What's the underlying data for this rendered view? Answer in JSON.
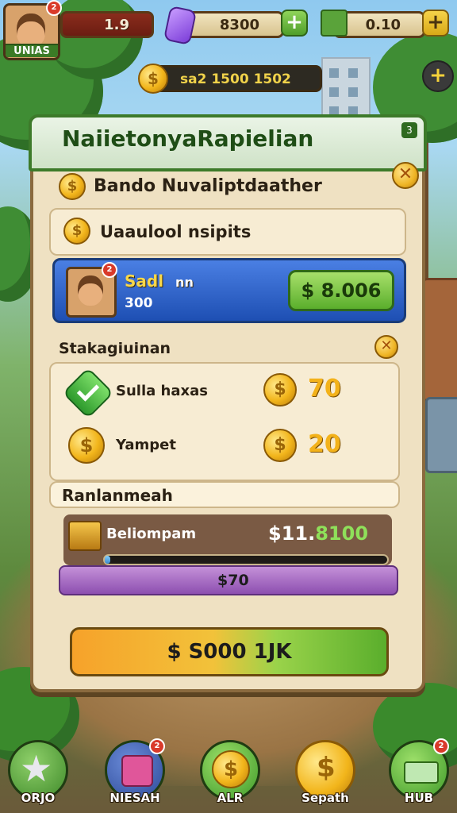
{
  "hud": {
    "player_label": "UNIAS",
    "player_badge": "2",
    "resource_1": "1.9",
    "resource_2": "8300",
    "resource_3": "0.10",
    "coins": "sa2 1500 1502"
  },
  "panel": {
    "title": "NaiietonyaRapielian",
    "title_badge": "3",
    "header_line": "Bando Nuvaliptdaather",
    "subheader": "Uaaulool nsipits",
    "player": {
      "name": "Sadl",
      "suffix": "nn",
      "value": "300",
      "badge": "2",
      "price": "$ 8.006"
    },
    "section_label": "Stakagiuinan",
    "rewards": [
      {
        "label": "Sulla haxas",
        "amount": "70",
        "icon": "check-icon"
      },
      {
        "label": "Yampet",
        "amount": "20",
        "icon": "coin-icon"
      }
    ],
    "upgrade_section_label": "Ranlanmeah",
    "upgrade": {
      "label": "Beliompam",
      "price_prefix": "$11.",
      "price_suffix": "8100",
      "progress": 0.02
    },
    "purple_value": "$70",
    "buy_label": "$ S000 1JK"
  },
  "nav": [
    {
      "label": "ORJO",
      "badge": ""
    },
    {
      "label": "NIESAH",
      "badge": "2"
    },
    {
      "label": "ALR",
      "badge": ""
    },
    {
      "label": "Sepath",
      "badge": ""
    },
    {
      "label": "HUB",
      "badge": "2"
    }
  ],
  "colors": {
    "panel_bg": "#efe1c2",
    "title_green": "#1f4d16",
    "card_blue": "#1e4fb3",
    "buy_orange": "#f6a22a",
    "buy_green": "#5aae2c",
    "purple": "#8d4fb0"
  }
}
